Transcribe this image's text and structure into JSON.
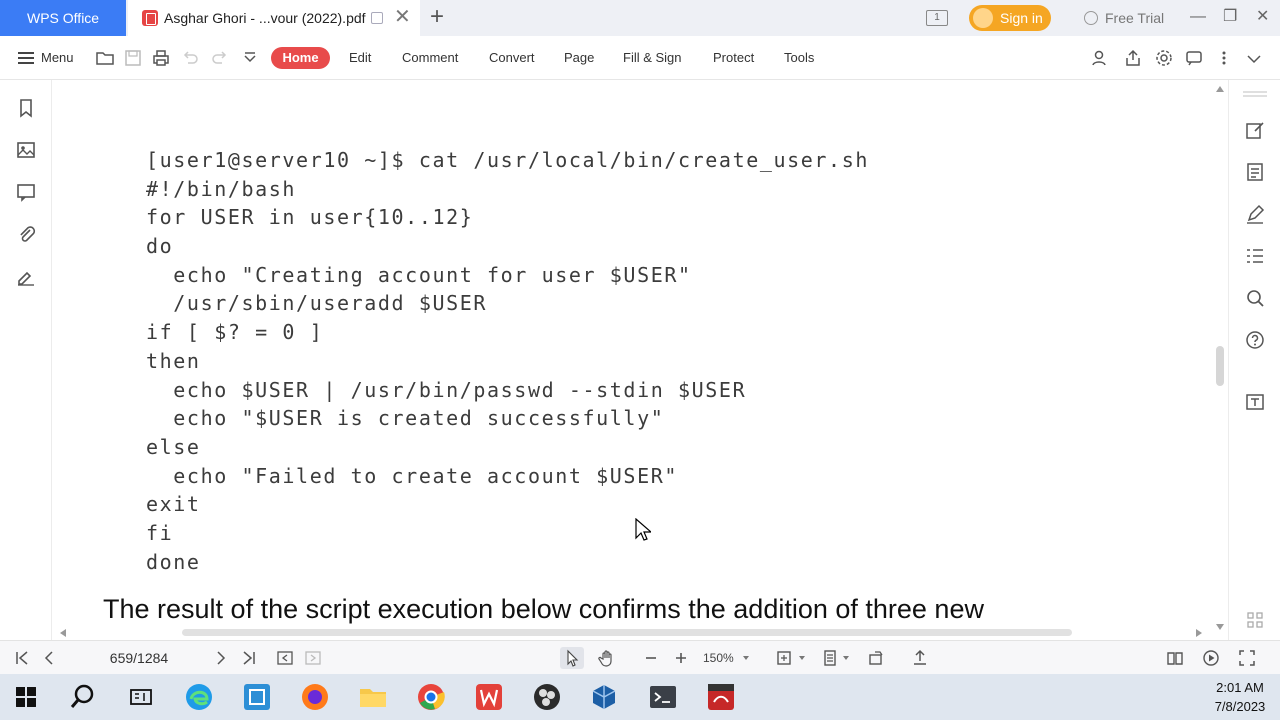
{
  "titlebar": {
    "app_tab": "WPS Office",
    "doc_tab_title": "Asghar Ghori - ...vour (2022).pdf",
    "panel_count": "1",
    "sign_in": "Sign in",
    "free_trial": "Free Trial"
  },
  "menubar": {
    "menu": "Menu",
    "tabs": [
      "Home",
      "Edit",
      "Comment",
      "Convert",
      "Page",
      "Fill & Sign",
      "Protect",
      "Tools"
    ]
  },
  "document": {
    "code_lines": [
      "[user1@server10 ~]$ cat /usr/local/bin/create_user.sh",
      "#!/bin/bash",
      "for USER in user{10..12}",
      "do",
      "  echo \"Creating account for user $USER\"",
      "  /usr/sbin/useradd $USER",
      "if [ $? = 0 ]",
      "then",
      "  echo $USER | /usr/bin/passwd --stdin $USER",
      "  echo \"$USER is created successfully\"",
      "else",
      "  echo \"Failed to create account $USER\"",
      "exit",
      "fi",
      "done"
    ],
    "body_text": "The result of the script execution below confirms the addition of three new"
  },
  "statusbar": {
    "page": "659/1284",
    "zoom": "150%"
  },
  "taskbar": {
    "time": "2:01 AM",
    "date": "7/8/2023"
  }
}
